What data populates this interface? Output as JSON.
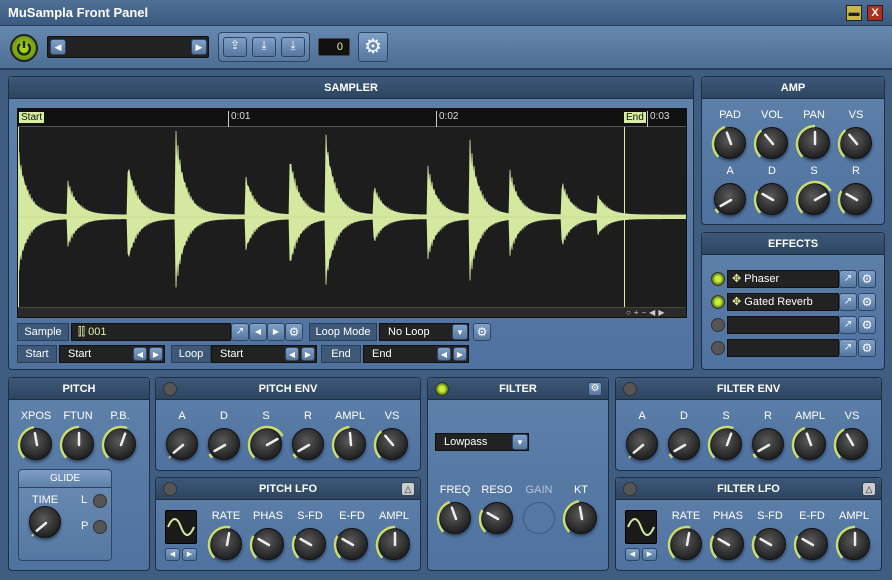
{
  "window": {
    "title": "MuSampla Front Panel",
    "minimize": "▬",
    "close": "X"
  },
  "toolbar": {
    "preset_counter": "0"
  },
  "sampler": {
    "title": "SAMPLER",
    "timeline": {
      "start": "Start",
      "end": "End",
      "ticks": [
        "0:01",
        "0:02",
        "0:03"
      ]
    },
    "sample_label": "Sample",
    "sample_value": "001",
    "loop_mode_label": "Loop Mode",
    "loop_mode_value": "No Loop",
    "start_label": "Start",
    "start_value": "Start",
    "loop_label": "Loop",
    "loop_value": "Start",
    "end_label": "End",
    "end_value": "End"
  },
  "amp": {
    "title": "AMP",
    "row1": [
      "PAD",
      "VOL",
      "PAN",
      "VS"
    ],
    "row2": [
      "A",
      "D",
      "S",
      "R"
    ]
  },
  "effects": {
    "title": "EFFECTS",
    "slots": [
      {
        "name": "Phaser",
        "on": true
      },
      {
        "name": "Gated Reverb",
        "on": true
      },
      {
        "name": "",
        "on": false
      },
      {
        "name": "",
        "on": false
      }
    ]
  },
  "pitch": {
    "title": "PITCH",
    "knobs": [
      "XPOS",
      "FTUN",
      "P.B."
    ],
    "glide_title": "GLIDE",
    "glide_time": "TIME",
    "glide_l": "L",
    "glide_p": "P"
  },
  "pitch_env": {
    "title": "PITCH ENV",
    "knobs": [
      "A",
      "D",
      "S",
      "R",
      "AMPL",
      "VS"
    ]
  },
  "pitch_lfo": {
    "title": "PITCH LFO",
    "knobs": [
      "RATE",
      "PHAS",
      "S-FD",
      "E-FD",
      "AMPL"
    ]
  },
  "filter": {
    "title": "FILTER",
    "type": "Lowpass",
    "knobs": [
      "FREQ",
      "RESO",
      "GAIN",
      "KT"
    ]
  },
  "filter_env": {
    "title": "FILTER ENV",
    "knobs": [
      "A",
      "D",
      "S",
      "R",
      "AMPL",
      "VS"
    ]
  },
  "filter_lfo": {
    "title": "FILTER LFO",
    "knobs": [
      "RATE",
      "PHAS",
      "S-FD",
      "E-FD",
      "AMPL"
    ]
  }
}
